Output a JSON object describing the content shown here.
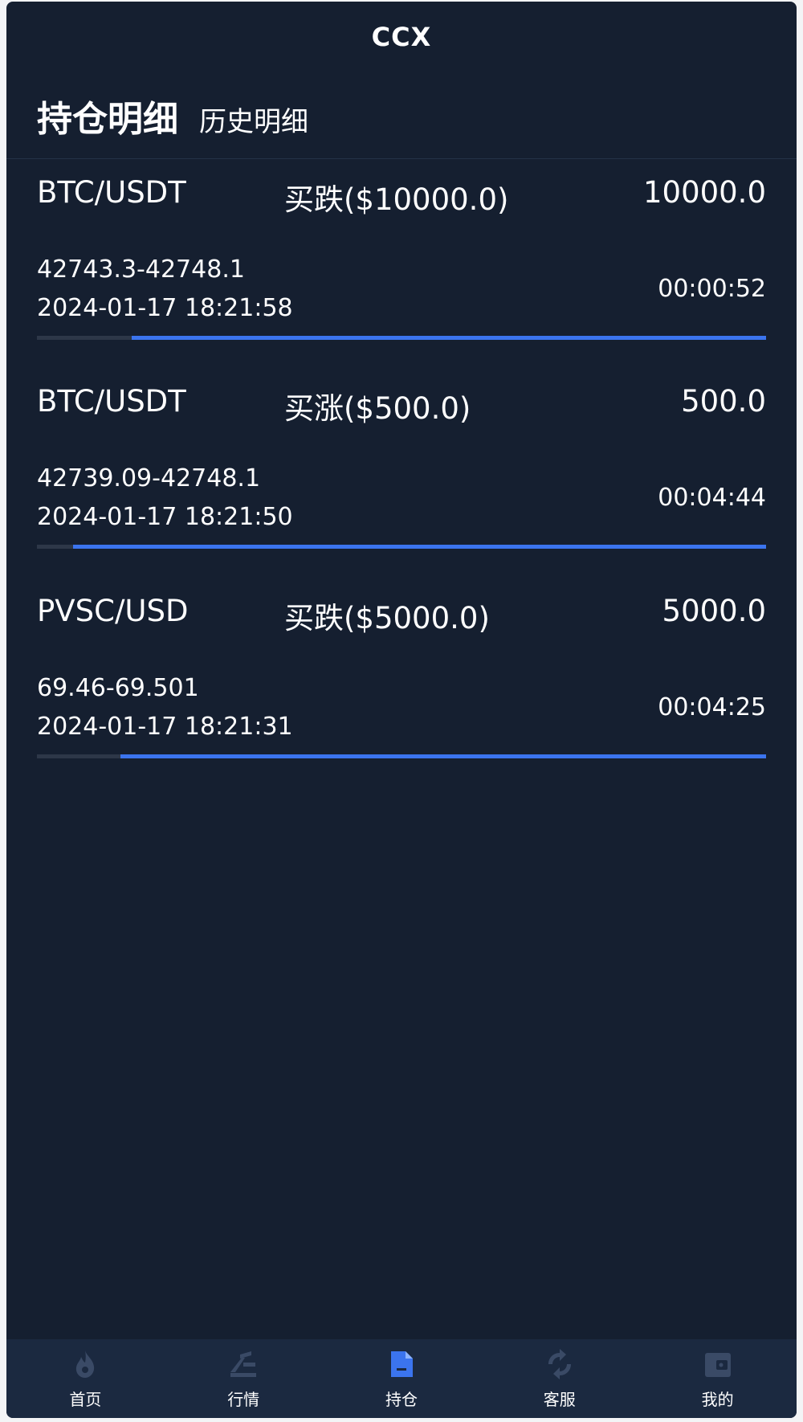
{
  "header": {
    "title": "CCX"
  },
  "tabs": {
    "active": "持仓明细",
    "other": "历史明细"
  },
  "positions": [
    {
      "pair": "BTC/USDT",
      "direction": "买跌($10000.0)",
      "amount": "10000.0",
      "range": "42743.3-42748.1",
      "datetime": "2024-01-17 18:21:58",
      "countdown": "00:00:52",
      "progress": 0.87
    },
    {
      "pair": "BTC/USDT",
      "direction": "买涨($500.0)",
      "amount": "500.0",
      "range": "42739.09-42748.1",
      "datetime": "2024-01-17 18:21:50",
      "countdown": "00:04:44",
      "progress": 0.95
    },
    {
      "pair": "PVSC/USD",
      "direction": "买跌($5000.0)",
      "amount": "5000.0",
      "range": "69.46-69.501",
      "datetime": "2024-01-17 18:21:31",
      "countdown": "00:04:25",
      "progress": 0.885
    }
  ],
  "nav": {
    "items": [
      {
        "label": "首页",
        "icon": "flame-icon"
      },
      {
        "label": "行情",
        "icon": "market-icon"
      },
      {
        "label": "持仓",
        "icon": "document-icon"
      },
      {
        "label": "客服",
        "icon": "refresh-icon"
      },
      {
        "label": "我的",
        "icon": "wallet-icon"
      }
    ],
    "active_index": 2
  },
  "colors": {
    "background": "#151f30",
    "accent": "#3b74ee",
    "nav_background": "#1b2940",
    "inactive_icon": "#3a4a66"
  }
}
